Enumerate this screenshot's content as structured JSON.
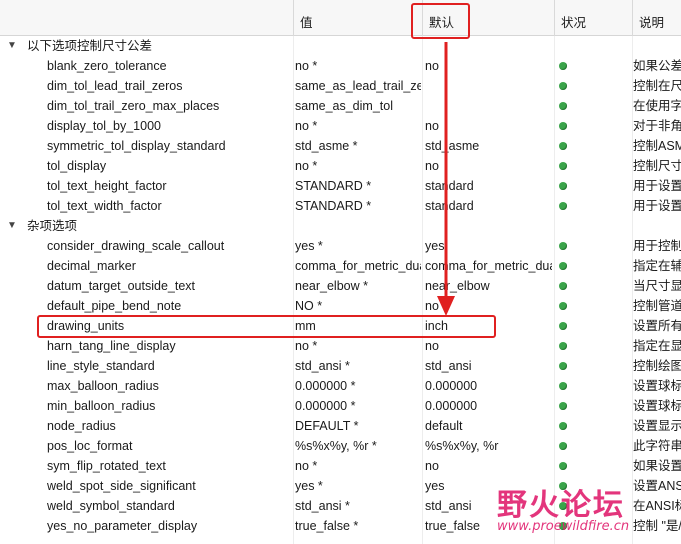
{
  "header": {
    "value_col": "值",
    "default_col": "默认",
    "status_col": "状况",
    "desc_col": "说明"
  },
  "groups": [
    {
      "label": "以下选项控制尺寸公差",
      "arrow": "▼"
    },
    {
      "label": "杂项选项",
      "arrow": "▼"
    }
  ],
  "rows": [
    {
      "name": "blank_zero_tolerance",
      "value": "no *",
      "default": "no",
      "desc": "如果公差"
    },
    {
      "name": "dim_tol_lead_trail_zeros",
      "value": "same_as_lead_trail_zeros",
      "default": "",
      "desc": "控制在尺"
    },
    {
      "name": "dim_tol_trail_zero_max_places",
      "value": "same_as_dim_tol",
      "default": "",
      "desc": "在使用字"
    },
    {
      "name": "display_tol_by_1000",
      "value": "no *",
      "default": "no",
      "desc": "对于非角"
    },
    {
      "name": "symmetric_tol_display_standard",
      "value": "std_asme *",
      "default": "std_asme",
      "desc": "控制ASM"
    },
    {
      "name": "tol_display",
      "value": "no *",
      "default": "no",
      "desc": "控制尺寸"
    },
    {
      "name": "tol_text_height_factor",
      "value": "STANDARD *",
      "default": "standard",
      "desc": "用于设置"
    },
    {
      "name": "tol_text_width_factor",
      "value": "STANDARD *",
      "default": "standard",
      "desc": "用于设置"
    },
    {
      "name": "consider_drawing_scale_callout",
      "value": "yes *",
      "default": "yes",
      "desc": "用于控制"
    },
    {
      "name": "decimal_marker",
      "value": "comma_for_metric_dual",
      "default": "comma_for_metric_dual",
      "desc": "指定在辅"
    },
    {
      "name": "datum_target_outside_text",
      "value": "near_elbow *",
      "default": "near_elbow",
      "desc": "当尺寸显"
    },
    {
      "name": "default_pipe_bend_note",
      "value": "NO *",
      "default": "no",
      "desc": "控制管道"
    },
    {
      "name": "drawing_units",
      "value": "mm",
      "default": "inch",
      "desc": "设置所有"
    },
    {
      "name": "harn_tang_line_display",
      "value": "no *",
      "default": "no",
      "desc": "指定在显"
    },
    {
      "name": "line_style_standard",
      "value": "std_ansi *",
      "default": "std_ansi",
      "desc": "控制绘图"
    },
    {
      "name": "max_balloon_radius",
      "value": "0.000000 *",
      "default": "0.000000",
      "desc": "设置球标"
    },
    {
      "name": "min_balloon_radius",
      "value": "0.000000 *",
      "default": "0.000000",
      "desc": "设置球标"
    },
    {
      "name": "node_radius",
      "value": "DEFAULT *",
      "default": "default",
      "desc": "设置显示"
    },
    {
      "name": "pos_loc_format",
      "value": "%s%x%y, %r *",
      "default": "%s%x%y, %r",
      "desc": "此字符串"
    },
    {
      "name": "sym_flip_rotated_text",
      "value": "no *",
      "default": "no",
      "desc": "如果设置"
    },
    {
      "name": "weld_spot_side_significant",
      "value": "yes *",
      "default": "yes",
      "desc": "设置ANS"
    },
    {
      "name": "weld_symbol_standard",
      "value": "std_ansi *",
      "default": "std_ansi",
      "desc": "在ANSI标"
    },
    {
      "name": "yes_no_parameter_display",
      "value": "true_false *",
      "default": "true_false",
      "desc": "控制 \"是/"
    }
  ],
  "watermark": {
    "text": "野火论坛",
    "url": "www.proewildfire.cn"
  },
  "colors": {
    "highlight": "#e02020",
    "status_ok": "#3aa44a",
    "watermark": "#e0206e"
  }
}
